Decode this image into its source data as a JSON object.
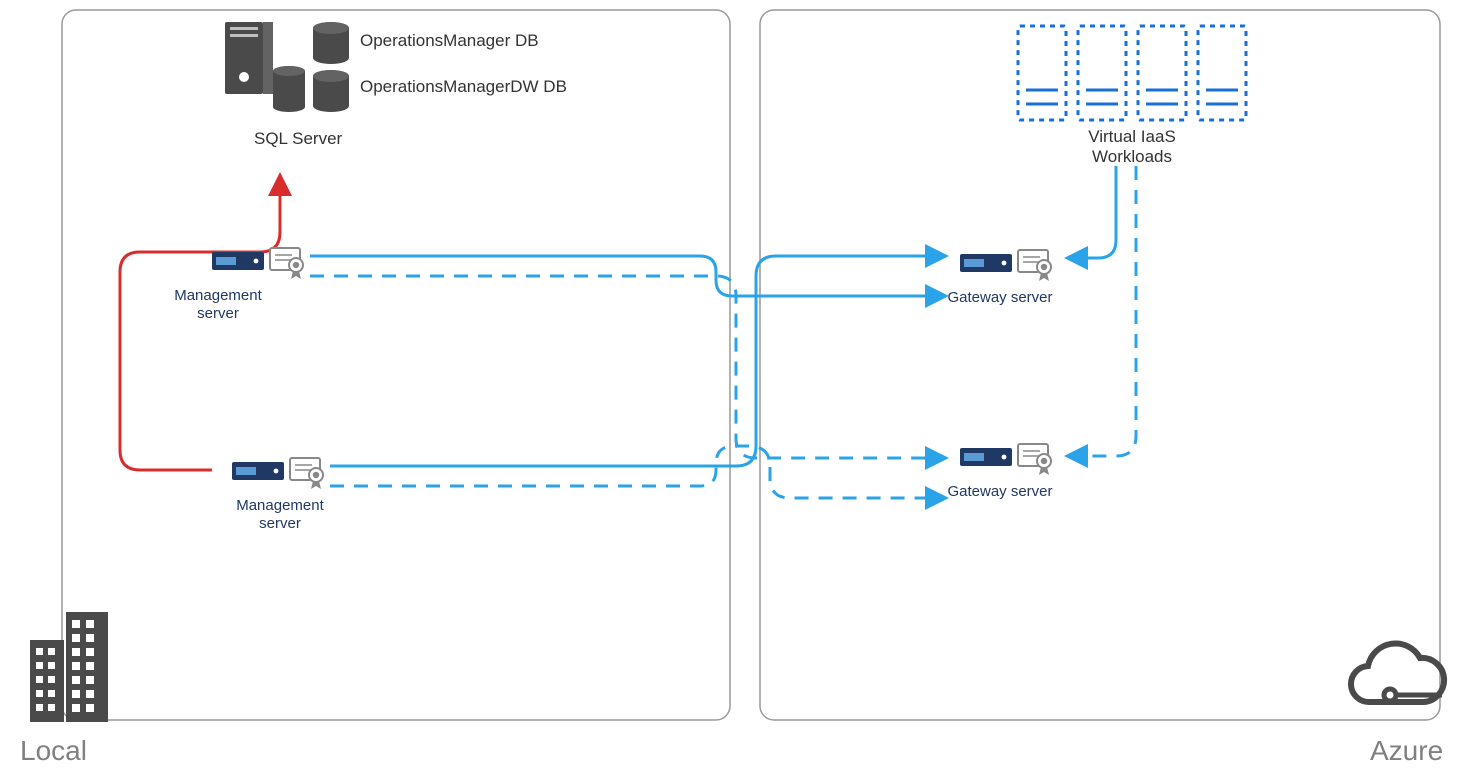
{
  "environments": {
    "local_label": "Local",
    "azure_label": "Azure"
  },
  "sql": {
    "server_label": "SQL Server",
    "db1_label": "OperationsManager DB",
    "db2_label": "OperationsManagerDW DB"
  },
  "management_server1_label_line1": "Management",
  "management_server1_label_line2": "server",
  "management_server2_label_line1": "Management",
  "management_server2_label_line2": "server",
  "gateway_server1_label": "Gateway server",
  "gateway_server2_label": "Gateway server",
  "workloads_label_line1": "Virtual IaaS",
  "workloads_label_line2": "Workloads",
  "colors": {
    "red": "#d92c2c",
    "blue": "#2aa3e8",
    "navy": "#203864",
    "azure_blue": "#1a6fd6",
    "icon_gray": "#4a4a4a"
  }
}
